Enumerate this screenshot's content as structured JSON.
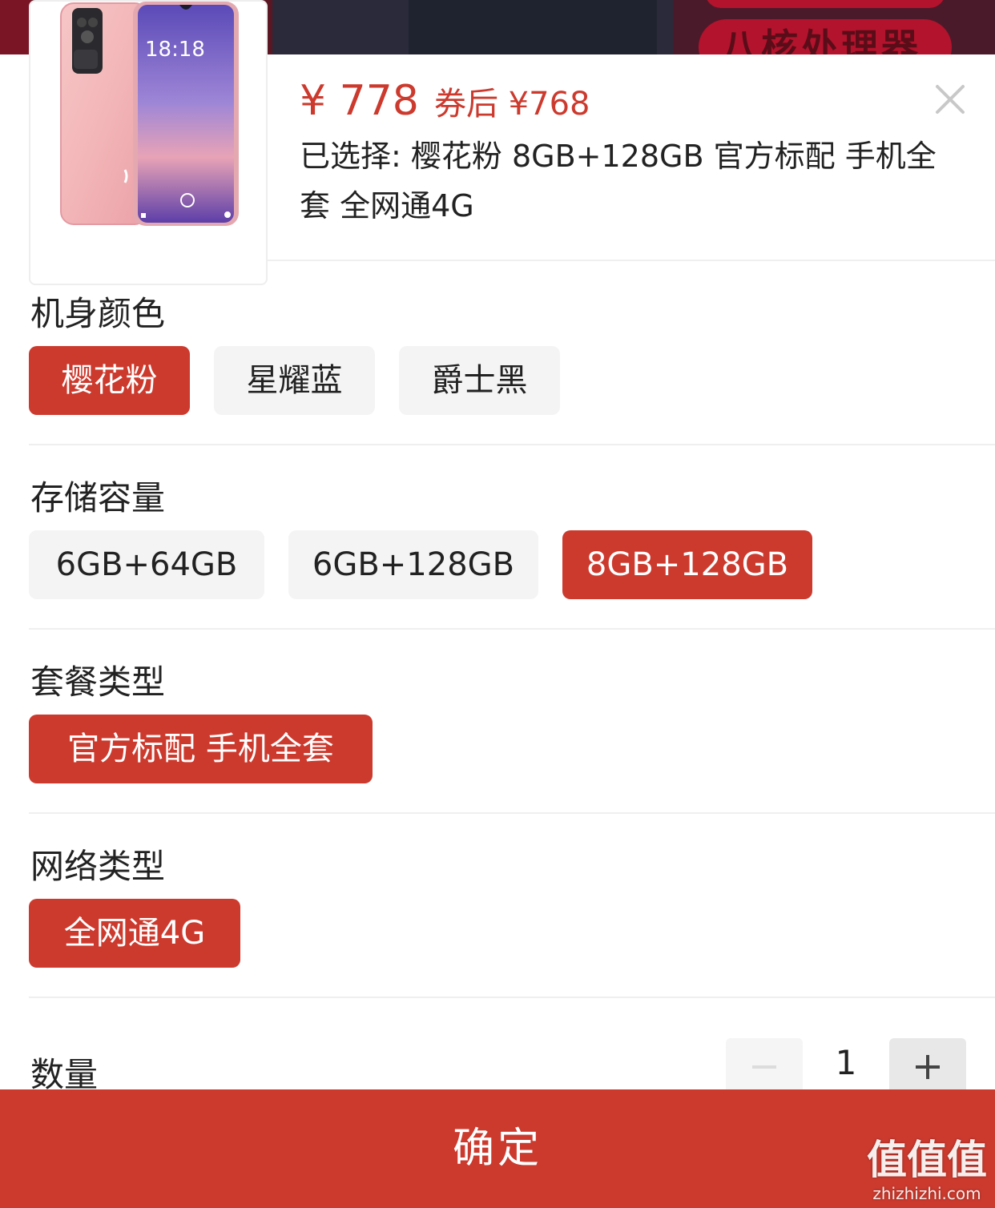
{
  "banner": {
    "text": "八核处理器"
  },
  "product": {
    "image_alt": "pink smartphone",
    "screen_time": "18:18",
    "price": "¥ 778",
    "coupon_price": "券后 ¥768",
    "selected_summary": "已选择: 樱花粉 8GB+128GB 官方标配 手机全套 全网通4G"
  },
  "sections": {
    "color": {
      "title": "机身颜色",
      "options": [
        "樱花粉",
        "星耀蓝",
        "爵士黑"
      ],
      "selected": "樱花粉"
    },
    "storage": {
      "title": "存储容量",
      "options": [
        "6GB+64GB",
        "6GB+128GB",
        "8GB+128GB"
      ],
      "selected": "8GB+128GB"
    },
    "package": {
      "title": "套餐类型",
      "options": [
        "官方标配 手机全套"
      ],
      "selected": "官方标配 手机全套"
    },
    "network": {
      "title": "网络类型",
      "options": [
        "全网通4G"
      ],
      "selected": "全网通4G"
    }
  },
  "quantity": {
    "label": "数量",
    "value": "1"
  },
  "confirm_label": "确定",
  "watermark": {
    "logo": "值值值",
    "url": "zhizhizhi.com"
  },
  "colors": {
    "accent": "#cc3a2e",
    "option_bg": "#f4f4f4",
    "text": "#222222"
  },
  "icons": {
    "close": "close-icon",
    "minus": "minus-icon",
    "plus": "plus-icon"
  }
}
